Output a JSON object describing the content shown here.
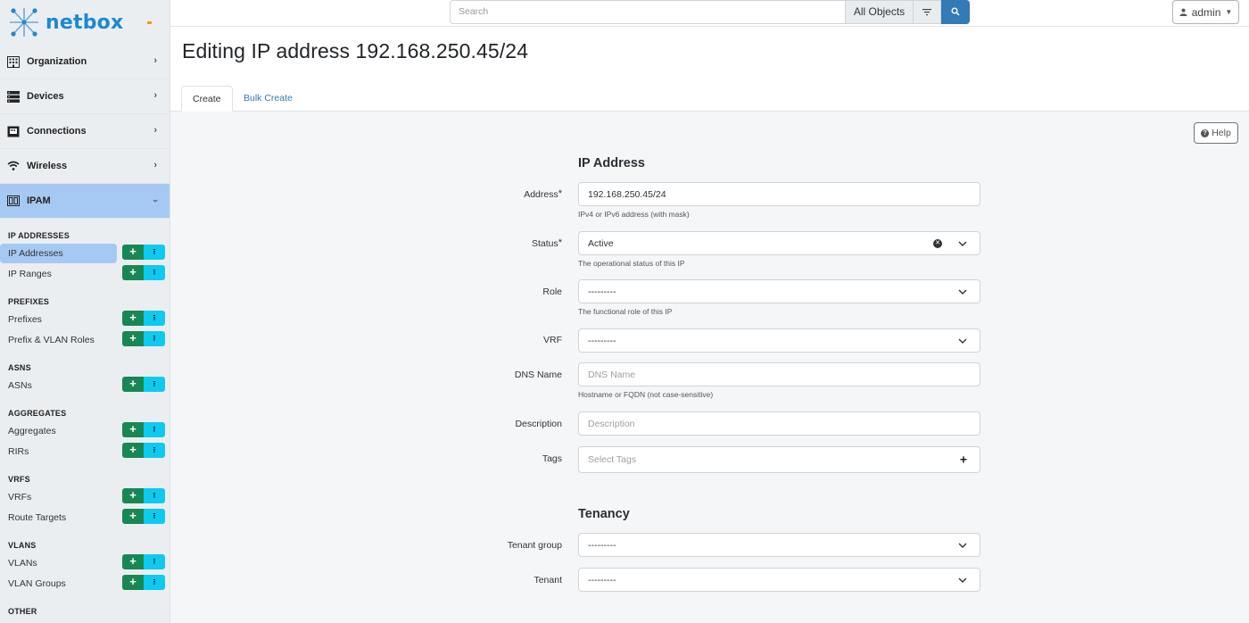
{
  "brand": {
    "name": "netbox"
  },
  "sidebar": {
    "menus": [
      {
        "label": "Organization",
        "icon": "building-icon"
      },
      {
        "label": "Devices",
        "icon": "server-icon"
      },
      {
        "label": "Connections",
        "icon": "ethernet-icon"
      },
      {
        "label": "Wireless",
        "icon": "wifi-icon"
      },
      {
        "label": "IPAM",
        "icon": "ipam-icon",
        "expanded": true
      }
    ],
    "groups": [
      {
        "title": "IP ADDRESSES",
        "items": [
          {
            "label": "IP Addresses",
            "active": true
          },
          {
            "label": "IP Ranges"
          }
        ]
      },
      {
        "title": "PREFIXES",
        "items": [
          {
            "label": "Prefixes"
          },
          {
            "label": "Prefix & VLAN Roles"
          }
        ]
      },
      {
        "title": "ASNS",
        "items": [
          {
            "label": "ASNs"
          }
        ]
      },
      {
        "title": "AGGREGATES",
        "items": [
          {
            "label": "Aggregates"
          },
          {
            "label": "RIRs"
          }
        ]
      },
      {
        "title": "VRFS",
        "items": [
          {
            "label": "VRFs"
          },
          {
            "label": "Route Targets"
          }
        ]
      },
      {
        "title": "VLANS",
        "items": [
          {
            "label": "VLANs"
          },
          {
            "label": "VLAN Groups"
          }
        ]
      },
      {
        "title": "OTHER",
        "items": []
      }
    ]
  },
  "topbar": {
    "search_placeholder": "Search",
    "scope_label": "All Objects",
    "user_label": "admin"
  },
  "page": {
    "title": "Editing IP address 192.168.250.45/24",
    "tabs": [
      {
        "label": "Create",
        "active": true
      },
      {
        "label": "Bulk Create"
      }
    ],
    "help_label": "Help"
  },
  "form": {
    "sections": [
      {
        "title": "IP Address"
      },
      {
        "title": "Tenancy"
      }
    ],
    "fields": {
      "address": {
        "label": "Address",
        "required": "*",
        "value": "192.168.250.45/24",
        "hint": "IPv4 or IPv6 address (with mask)"
      },
      "status": {
        "label": "Status",
        "required": "*",
        "value": "Active",
        "hint": "The operational status of this IP"
      },
      "role": {
        "label": "Role",
        "value": "---------",
        "hint": "The functional role of this IP"
      },
      "vrf": {
        "label": "VRF",
        "value": "---------"
      },
      "dns_name": {
        "label": "DNS Name",
        "placeholder": "DNS Name",
        "hint": "Hostname or FQDN (not case-sensitive)"
      },
      "description": {
        "label": "Description",
        "placeholder": "Description"
      },
      "tags": {
        "label": "Tags",
        "placeholder": "Select Tags"
      },
      "tenant_group": {
        "label": "Tenant group",
        "value": "---------"
      },
      "tenant": {
        "label": "Tenant",
        "value": "---------"
      }
    }
  },
  "colors": {
    "accent": "#337ab7",
    "active_bg": "#a6c9f3",
    "add_green": "#198754",
    "import_cyan": "#0dcaf0"
  }
}
